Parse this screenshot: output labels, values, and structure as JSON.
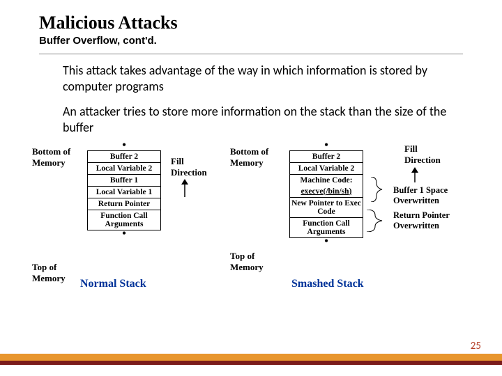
{
  "title": "Malicious Attacks",
  "subtitle": "Buffer Overflow, cont'd.",
  "para1": "This attack takes advantage of the way in which information is stored by computer programs",
  "para2": "An attacker tries to store more information on the stack than the size of the buffer",
  "labels": {
    "bottom": "Bottom of Memory",
    "top": "Top of Memory",
    "fill": "Fill Direction"
  },
  "stack1": {
    "rows": [
      "Buffer 2",
      "Local Variable 2",
      "Buffer 1",
      "Local Variable 1",
      "Return Pointer",
      "Function Call Arguments"
    ],
    "caption": "Normal Stack"
  },
  "stack2": {
    "rows": [
      "Buffer 2",
      "Local Variable 2",
      "Machine Code:",
      "execve(/bin/sh)",
      "New Pointer to Exec Code",
      "Function Call Arguments"
    ],
    "caption": "Smashed Stack"
  },
  "notes": {
    "n1": "Buffer 1 Space Overwritten",
    "n2": "Return Pointer Overwritten"
  },
  "pagenum": "25"
}
